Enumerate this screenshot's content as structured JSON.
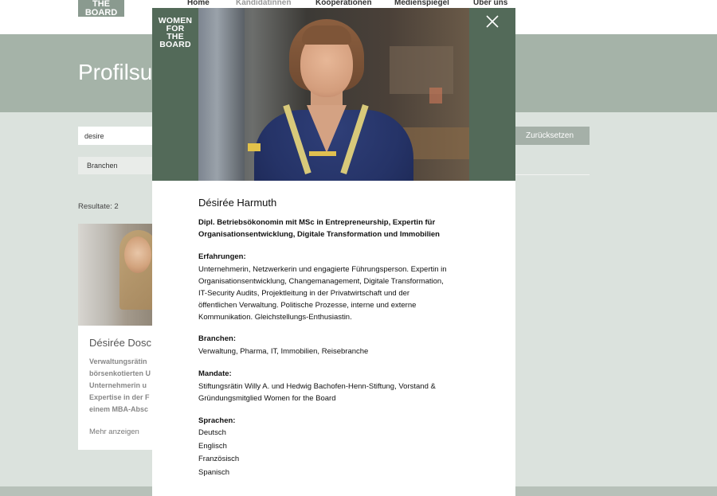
{
  "site": {
    "logo": [
      "THE",
      "BOARD"
    ],
    "nav": [
      "Home",
      "Kandidatinnen",
      "Kooperationen",
      "Medienspiegel",
      "Über uns"
    ],
    "hero_title": "Profilsu"
  },
  "search": {
    "value": "desire",
    "reset_label": "Zurücksetzen",
    "filter_branchen": "Branchen",
    "results_label": "Resultate: 2"
  },
  "card": {
    "name": "Désirée Dosc",
    "desc": [
      "Verwaltungsrätin",
      "börsenkotierten U",
      "Unternehmerin u",
      "Expertise in der F",
      "einem MBA-Absc"
    ],
    "more_label": "Mehr anzeigen"
  },
  "modal": {
    "logo": [
      "WOMEN",
      "FOR",
      "THE",
      "BOARD"
    ],
    "name": "Désirée Harmuth",
    "title_lines": [
      "Dipl. Betriebsökonomin mit MSc in Entrepreneurship, Expertin für",
      "Organisationsentwicklung, Digitale Transformation und Immobilien"
    ],
    "sections": {
      "erfahrungen": {
        "heading": "Erfahrungen:",
        "lines": [
          "Unternehmerin, Netzwerkerin und engagierte Führungsperson. Expertin in",
          "Organisationsentwicklung, Changemanagement, Digitale Transformation,",
          "IT-Security Audits, Projektleitung in der Privatwirtschaft und der",
          "öffentlichen Verwaltung. Politische Prozesse, interne und externe",
          "Kommunikation. Gleichstellungs-Enthusiastin."
        ]
      },
      "branchen": {
        "heading": "Branchen:",
        "lines": [
          "Verwaltung, Pharma, IT, Immobilien, Reisebranche"
        ]
      },
      "mandate": {
        "heading": "Mandate:",
        "lines": [
          "Stiftungsrätin Willy A. und Hedwig Bachofen-Henn-Stiftung, Vorstand &",
          "Gründungsmitglied Women for the Board"
        ]
      },
      "sprachen": {
        "heading": "Sprachen:",
        "items": [
          "Deutsch",
          "Englisch",
          "Französisch",
          "Spanisch"
        ]
      }
    }
  },
  "colors": {
    "accent_green": "#536a59",
    "hero_bg": "#a5b3a8",
    "page_bg": "#dbe2dd"
  }
}
